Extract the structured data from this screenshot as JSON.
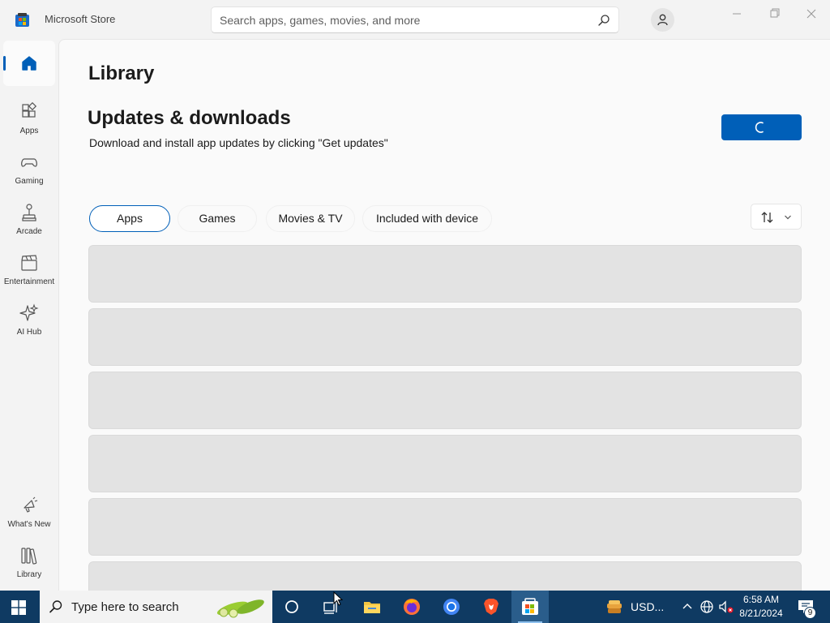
{
  "window": {
    "title": "Microsoft Store",
    "search_placeholder": "Search apps, games, movies, and more"
  },
  "sidebar": {
    "items": [
      {
        "label": "",
        "icon": "home-icon"
      },
      {
        "label": "Apps",
        "icon": "apps-icon"
      },
      {
        "label": "Gaming",
        "icon": "gamepad-icon"
      },
      {
        "label": "Arcade",
        "icon": "joystick-icon"
      },
      {
        "label": "Entertainment",
        "icon": "clapperboard-icon"
      },
      {
        "label": "AI Hub",
        "icon": "sparkle-icon"
      },
      {
        "label": "What's New",
        "icon": "megaphone-icon"
      },
      {
        "label": "Library",
        "icon": "library-icon"
      }
    ]
  },
  "main": {
    "page_title": "Library",
    "section_title": "Updates & downloads",
    "section_subtitle": "Download and install app updates by clicking \"Get updates\"",
    "filters": [
      "Apps",
      "Games",
      "Movies & TV",
      "Included with device"
    ],
    "active_filter": "Apps"
  },
  "taskbar": {
    "search_text": "Type here to search",
    "weather_text": "USD...",
    "time": "6:58 AM",
    "date": "8/21/2024",
    "notification_count": "9"
  },
  "colors": {
    "accent": "#005fb8",
    "taskbar": "#0f3a62",
    "skeleton": "#e3e3e3"
  }
}
